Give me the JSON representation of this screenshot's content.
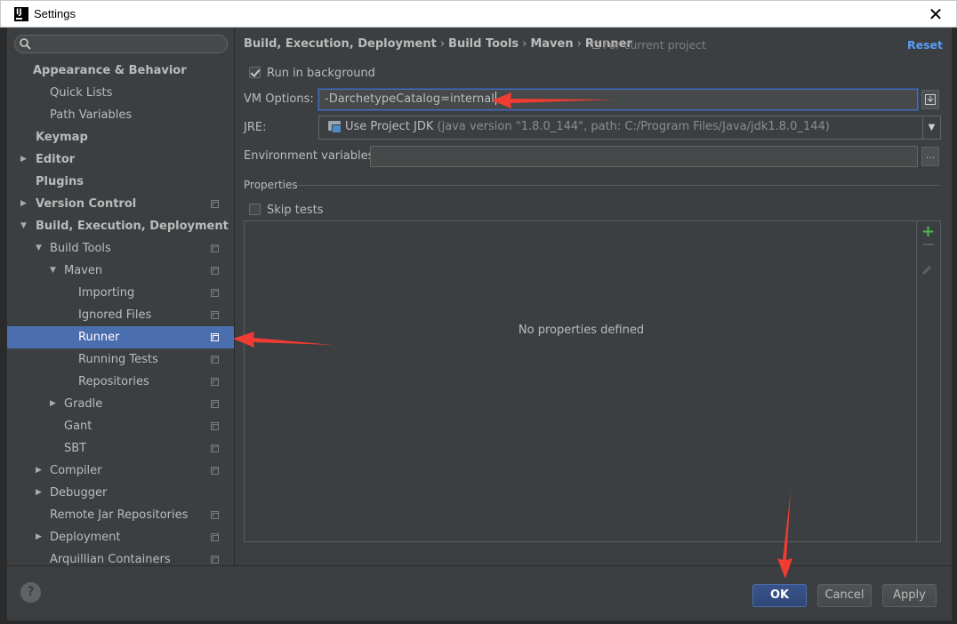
{
  "window": {
    "title": "Settings",
    "logo_text": "IJ"
  },
  "search": {
    "placeholder": "",
    "value": ""
  },
  "tree": [
    {
      "label": "Appearance & Behavior",
      "bold": true,
      "level": 0,
      "arrow": "",
      "proj": false
    },
    {
      "label": "Quick Lists",
      "bold": false,
      "level": 1,
      "arrow": "",
      "proj": false
    },
    {
      "label": "Path Variables",
      "bold": false,
      "level": 1,
      "arrow": "",
      "proj": false
    },
    {
      "label": "Keymap",
      "bold": true,
      "level": 0,
      "arrow": "",
      "proj": false
    },
    {
      "label": "Editor",
      "bold": true,
      "level": 0,
      "arrow": "right",
      "proj": false
    },
    {
      "label": "Plugins",
      "bold": true,
      "level": 0,
      "arrow": "",
      "proj": false
    },
    {
      "label": "Version Control",
      "bold": true,
      "level": 0,
      "arrow": "right",
      "proj": true
    },
    {
      "label": "Build, Execution, Deployment",
      "bold": true,
      "level": 0,
      "arrow": "down",
      "proj": false
    },
    {
      "label": "Build Tools",
      "bold": false,
      "level": 1,
      "arrow": "down",
      "proj": true
    },
    {
      "label": "Maven",
      "bold": false,
      "level": 2,
      "arrow": "down",
      "proj": true
    },
    {
      "label": "Importing",
      "bold": false,
      "level": 3,
      "arrow": "",
      "proj": true
    },
    {
      "label": "Ignored Files",
      "bold": false,
      "level": 3,
      "arrow": "",
      "proj": true
    },
    {
      "label": "Runner",
      "bold": false,
      "level": 3,
      "arrow": "",
      "proj": true,
      "selected": true
    },
    {
      "label": "Running Tests",
      "bold": false,
      "level": 3,
      "arrow": "",
      "proj": true
    },
    {
      "label": "Repositories",
      "bold": false,
      "level": 3,
      "arrow": "",
      "proj": true
    },
    {
      "label": "Gradle",
      "bold": false,
      "level": 2,
      "arrow": "right",
      "proj": true
    },
    {
      "label": "Gant",
      "bold": false,
      "level": 2,
      "arrow": "",
      "proj": true
    },
    {
      "label": "SBT",
      "bold": false,
      "level": 2,
      "arrow": "",
      "proj": true
    },
    {
      "label": "Compiler",
      "bold": false,
      "level": 1,
      "arrow": "right",
      "proj": true
    },
    {
      "label": "Debugger",
      "bold": false,
      "level": 1,
      "arrow": "right",
      "proj": false
    },
    {
      "label": "Remote Jar Repositories",
      "bold": false,
      "level": 1,
      "arrow": "",
      "proj": true
    },
    {
      "label": "Deployment",
      "bold": false,
      "level": 1,
      "arrow": "right",
      "proj": true
    },
    {
      "label": "Arquillian Containers",
      "bold": false,
      "level": 1,
      "arrow": "",
      "proj": true
    }
  ],
  "breadcrumb": [
    "Build, Execution, Deployment",
    "Build Tools",
    "Maven",
    "Runner"
  ],
  "breadcrumb_sep": "›",
  "for_current_project": "For current project",
  "reset_label": "Reset",
  "run_in_background": {
    "label": "Run in background",
    "checked": true
  },
  "vm_options": {
    "label": "VM Options:",
    "value": "-DarchetypeCatalog=internal"
  },
  "jre": {
    "label": "JRE:",
    "value": "Use Project JDK",
    "detail": "(java version \"1.8.0_144\", path: C:/Program Files/Java/jdk1.8.0_144)"
  },
  "env_vars": {
    "label": "Environment variables:",
    "value": "",
    "button": "..."
  },
  "properties": {
    "title": "Properties",
    "empty_text": "No properties defined"
  },
  "skip_tests": {
    "label": "Skip tests",
    "checked": false
  },
  "buttons": {
    "help": "?",
    "ok": "OK",
    "cancel": "Cancel",
    "apply": "Apply"
  },
  "colors": {
    "accent": "#4b6eaf",
    "annotation_arrow": "#f03c32",
    "add_green": "#4cb74c"
  }
}
